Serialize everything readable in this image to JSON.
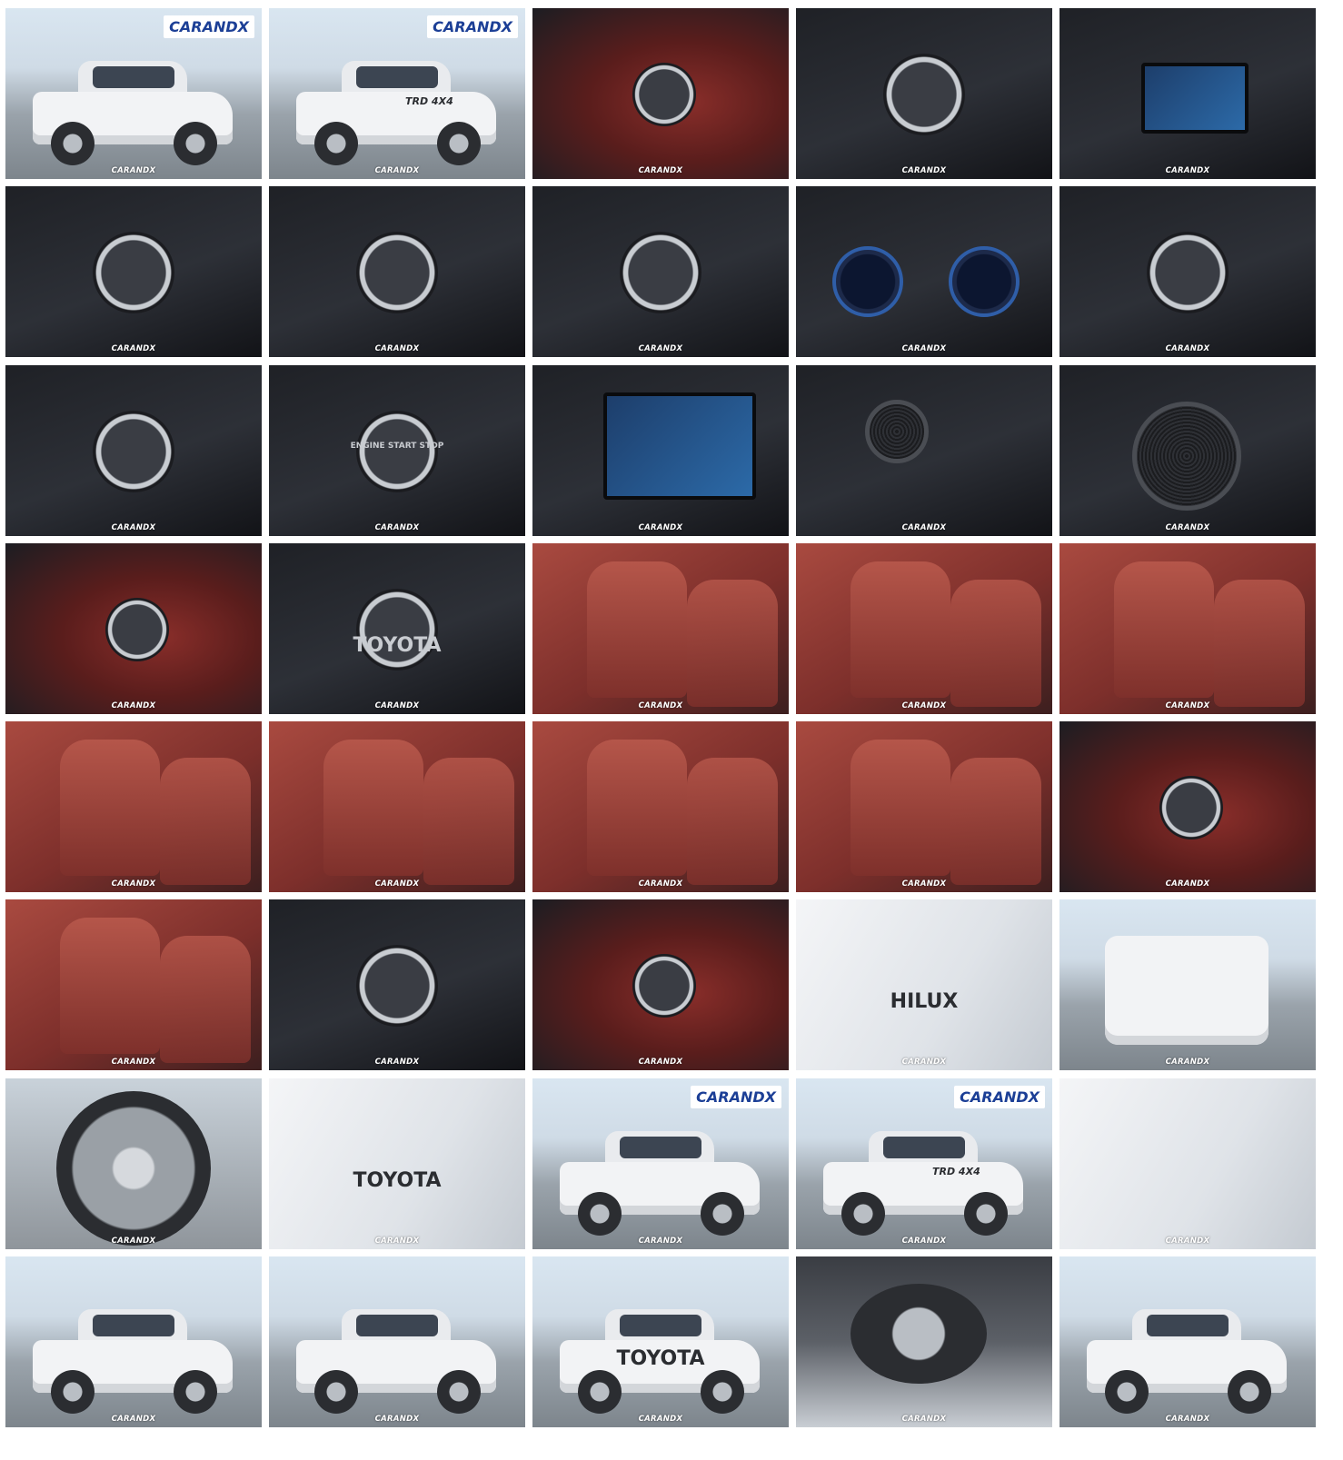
{
  "gallery": {
    "watermark": "CARANDX",
    "thumbnails": [
      {
        "scene": "exterior-front-three-quarter",
        "palette": "s-ext",
        "sign": "CARANDX"
      },
      {
        "scene": "exterior-rear-three-quarter",
        "palette": "s-ext",
        "sign": "CARANDX",
        "badge": "TRD 4X4"
      },
      {
        "scene": "gear-shifter-closeup",
        "palette": "s-int-red"
      },
      {
        "scene": "gear-shifter-top",
        "palette": "s-dash"
      },
      {
        "scene": "center-console-screen",
        "palette": "s-dash"
      },
      {
        "scene": "steering-wheel-left-controls",
        "palette": "s-dash"
      },
      {
        "scene": "steering-wheel-right-controls",
        "palette": "s-dash"
      },
      {
        "scene": "cruise-control-stalk",
        "palette": "s-dash"
      },
      {
        "scene": "instrument-cluster",
        "palette": "s-dash"
      },
      {
        "scene": "climate-controls",
        "palette": "s-dash"
      },
      {
        "scene": "headlight-switch-and-knob",
        "palette": "s-dash"
      },
      {
        "scene": "engine-start-stop-button",
        "palette": "s-dash",
        "label": "ENGINE START STOP"
      },
      {
        "scene": "infotainment-screen",
        "palette": "s-dash"
      },
      {
        "scene": "dash-speaker-and-vent",
        "palette": "s-dash"
      },
      {
        "scene": "door-speaker",
        "palette": "s-dash"
      },
      {
        "scene": "door-window-switches",
        "palette": "s-int-red"
      },
      {
        "scene": "door-sill-plate",
        "palette": "s-dash",
        "label": "TOYOTA"
      },
      {
        "scene": "front-seat-detail",
        "palette": "s-seat"
      },
      {
        "scene": "front-seats",
        "palette": "s-seat"
      },
      {
        "scene": "rear-seats",
        "palette": "s-seat"
      },
      {
        "scene": "rear-cabin-view",
        "palette": "s-seat"
      },
      {
        "scene": "rear-armrest-cupholder",
        "palette": "s-seat"
      },
      {
        "scene": "center-armrest",
        "palette": "s-seat"
      },
      {
        "scene": "rear-seat-side",
        "palette": "s-seat"
      },
      {
        "scene": "door-panel-interior",
        "palette": "s-int-red"
      },
      {
        "scene": "cabin-from-rear",
        "palette": "s-seat"
      },
      {
        "scene": "steering-wheel",
        "palette": "s-dash"
      },
      {
        "scene": "rear-ac-vents",
        "palette": "s-int-red"
      },
      {
        "scene": "hilux-fender-badge",
        "palette": "s-white",
        "label": "HILUX"
      },
      {
        "scene": "front-view",
        "palette": "s-ext"
      },
      {
        "scene": "wheel-closeup",
        "palette": "s-wheel"
      },
      {
        "scene": "tailgate",
        "palette": "s-white",
        "label": "TOYOTA"
      },
      {
        "scene": "side-profile",
        "palette": "s-ext",
        "sign": "CARANDX"
      },
      {
        "scene": "rear-quarter-decal",
        "palette": "s-ext",
        "sign": "CARANDX",
        "badge": "TRD 4X4"
      },
      {
        "scene": "front-grille-headlight",
        "palette": "s-white"
      },
      {
        "scene": "front-three-quarter-left",
        "palette": "s-ext"
      },
      {
        "scene": "rear-three-quarter-right",
        "palette": "s-ext"
      },
      {
        "scene": "rear-three-quarter-left",
        "palette": "s-ext",
        "label": "TOYOTA"
      },
      {
        "scene": "underbody-spare-tire",
        "palette": "s-under"
      },
      {
        "scene": "front-three-quarter-lot",
        "palette": "s-ext"
      }
    ]
  }
}
